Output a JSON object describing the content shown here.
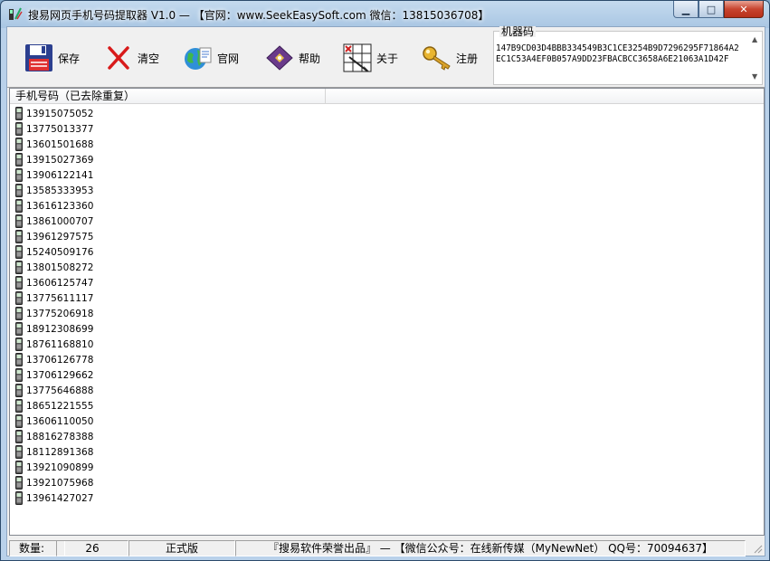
{
  "window": {
    "title": "搜易网页手机号码提取器 V1.0   —  【官网：www.SeekEasySoft.com 微信：13815036708】"
  },
  "toolbar": {
    "save_label": "保存",
    "clear_label": "清空",
    "website_label": "官网",
    "help_label": "帮助",
    "about_label": "关于",
    "register_label": "注册"
  },
  "machine_code": {
    "label": "机器码",
    "value": "147B9CD03D4BBB334549B3C1CE3254B9D7296295F71864A2EC1C53A4EF0B057A9DD23FBACBCC3658A6E21063A1D42F"
  },
  "list": {
    "column_header": "手机号码（已去除重复）",
    "numbers": [
      "13915075052",
      "13775013377",
      "13601501688",
      "13915027369",
      "13906122141",
      "13585333953",
      "13616123360",
      "13861000707",
      "13961297575",
      "15240509176",
      "13801508272",
      "13606125747",
      "13775611117",
      "13775206918",
      "18912308699",
      "18761168810",
      "13706126778",
      "13706129662",
      "13775646888",
      "18651221555",
      "13606110050",
      "18816278388",
      "18112891368",
      "13921090899",
      "13921075968",
      "13961427027"
    ]
  },
  "status": {
    "count_label": "数量:",
    "count_value": "26",
    "edition": "正式版",
    "credits": "『搜易软件荣誉出品』 — 【微信公众号：在线新传媒（MyNewNet） QQ号：70094637】"
  }
}
